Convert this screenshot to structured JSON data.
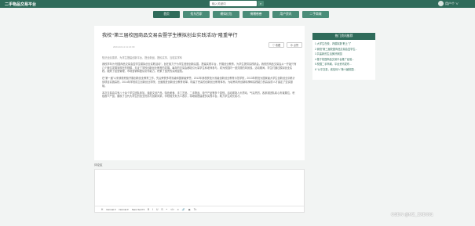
{
  "header": {
    "logo": "二手物品交易平台",
    "search_placeholder": "输入关键词",
    "user_name": "用户个 ∨"
  },
  "nav": [
    {
      "label": "首页"
    },
    {
      "label": "找东西家"
    },
    {
      "label": "模拟红包"
    },
    {
      "label": "捐赠慈善"
    },
    {
      "label": "用户资讯"
    },
    {
      "label": "二手商城"
    }
  ],
  "article": {
    "title": "我校“第三届校园商品交易会暨学生模拟创业实践活动”隆重举行",
    "meta": "2024-02-11 11:21:09",
    "fav_label": "♡ 收藏",
    "like_label": "⊕ 点赞",
    "summary": "知识全民需求、为学生搭建创新平台、搭全新品、搭民实事、当权实学科",
    "paragraphs": [
      "我校学年为“校园商品交易会暨学生模拟创业实践活动”，旨在致力于为学生营造创新氛围，搭建实践平台，开展创业教育，为学生提供实践机会。我校的商品交易会从一开始只有几个摊位发展到现在的规模，见证了学校创新创业教育的发展。每年的交易会都吸引大量学生和老师参与，成为校园内一道亮丽的风景线。活动期间，学生们通过模拟创业实践，锻炼了经营管理、市场营销和团队协作能力，积累了宝贵的实践经验。",
      "在“第一届”以来我校积极开展创新创业教育工作，先后荣获多项省级和国家级荣誉。2012年我校获批为省级创新创业教育示范学校，2013年获批为国家级大学生创新创业训练计划项目实施高校，2014年学校成立创新创业学院，全面推进创新创业教育改革，构建了完善的创新创业教育体系，为培养具有创新精神和实践能力的高素质人才奠定了坚实基础。",
      "本次交易会共有八十余个学生团队参加，涵盖文创产品、特色美食、手工艺品、二手物品、电子产品等多个类别。活动现场人头攒动，气氛热烈，各参赛团队精心布置展位，积极推介产品，展现了当代大学生的创业热情与创新风采。学校相关负责人表示，将继续搭建更多实践平台，助力学生成长成才。"
    ]
  },
  "comment": {
    "label": "评论区",
    "toolbar": {
      "size": "Normal",
      "header": "Normal",
      "font": "Sans Serif"
    }
  },
  "sidebar": {
    "title": "热门资讯推荐",
    "items": [
      "1 大学生在校、内模拟数“职上”了",
      "2 我校“第三届校园商品交易会暨学生...",
      "3 共建新的生活美好家园",
      "4 基于校园商品交易平台推广经验...",
      "5 校园二手商城、平台资讯发布...",
      "6 “公平交易，诚信待人”第十届校园..."
    ]
  },
  "watermark": "CSDN @MZ_ZXD001",
  "colors": {
    "brand": "#2f6b5a",
    "nav": "#4a8c78"
  }
}
